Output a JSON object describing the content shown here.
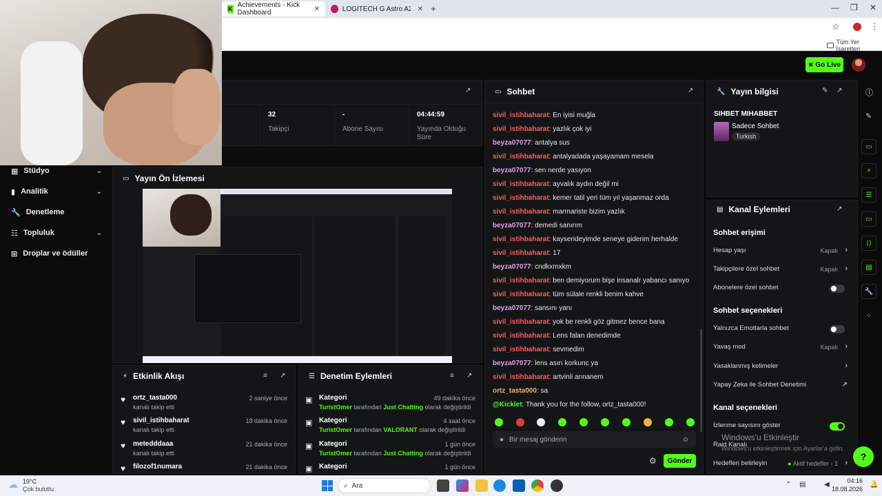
{
  "browser": {
    "tabs": [
      {
        "label": "Achievements - Kick Dashboard"
      },
      {
        "label": "LOGITECH G Astro A20 X Lightn"
      }
    ],
    "bookmarks_label": "Tüm Yer İşaretleri"
  },
  "header": {
    "go_live_label": "Go Live"
  },
  "stats": [
    {
      "value": "32",
      "label": "Takipçi"
    },
    {
      "value": "-",
      "label": "Abone Sayısı"
    },
    {
      "value": "04:44:59",
      "label": "Yayında Olduğu Süre"
    }
  ],
  "sidebar": {
    "items": [
      {
        "label": "Stüdyo",
        "icon": "studio-icon",
        "chevron": true
      },
      {
        "label": "Analitik",
        "icon": "analytics-icon",
        "chevron": true
      },
      {
        "label": "Denetleme",
        "icon": "wrench-icon",
        "chevron": false
      },
      {
        "label": "Topluluk",
        "icon": "community-icon",
        "chevron": true
      },
      {
        "label": "Droplar ve ödüller",
        "icon": "gift-icon",
        "chevron": false
      }
    ]
  },
  "preview": {
    "title": "Yayın Ön İzlemesi"
  },
  "activity": {
    "title": "Etkinlik Akışı",
    "items": [
      {
        "user": "ortz_tasta000",
        "action": "kanalı takip etti",
        "time": "2 saniye önce"
      },
      {
        "user": "sivil_istihbaharat",
        "action": "kanalı takip etti",
        "time": "18 dakika önce"
      },
      {
        "user": "metedddaaa",
        "action": "kanalı takip etti",
        "time": "21 dakika önce"
      },
      {
        "user": "filozof1numara",
        "action": "",
        "time": "21 dakika önce"
      }
    ]
  },
  "moderation": {
    "title": "Denetim Eylemleri",
    "items": [
      {
        "title": "Kategori",
        "actor": "TuristOmer",
        "mid": "tarafından",
        "value": "Just Chatting",
        "tail": "olarak değiştirildi",
        "time": "49 dakika önce"
      },
      {
        "title": "Kategori",
        "actor": "TuristOmer",
        "mid": "tarafından",
        "value": "VALORANT",
        "tail": "olarak değiştirildi",
        "time": "4 saat önce"
      },
      {
        "title": "Kategori",
        "actor": "TuristOmer",
        "mid": "tarafından",
        "value": "Just Chatting",
        "tail": "olarak değiştirildi",
        "time": "1 gün önce"
      },
      {
        "title": "Kategori",
        "actor": "",
        "mid": "",
        "value": "",
        "tail": "",
        "time": "1 gün önce"
      }
    ]
  },
  "chat": {
    "title": "Sohbet",
    "messages": [
      {
        "user": "sivil_istihbaharat",
        "text": "En iyisi muğla",
        "cls": "u1"
      },
      {
        "user": "sivil_istihbaharat",
        "text": "yazlık çok iyi",
        "cls": "u1"
      },
      {
        "user": "beyza07077",
        "text": "antalya sus",
        "cls": "u2"
      },
      {
        "user": "sivil_istihbaharat",
        "text": "antalyadada yaşayamam mesela",
        "cls": "u1"
      },
      {
        "user": "beyza07077",
        "text": "sen nerde yasıyon",
        "cls": "u2"
      },
      {
        "user": "sivil_istihbaharat",
        "text": "ayvalık aydın değil mi",
        "cls": "u1"
      },
      {
        "user": "sivil_istihbaharat",
        "text": "kemer tatil yeri tüm yıl yaşanmaz orda",
        "cls": "u1"
      },
      {
        "user": "sivil_istihbaharat",
        "text": "marmariste bizim yazlık",
        "cls": "u1"
      },
      {
        "user": "beyza07077",
        "text": "demedi sanırım",
        "cls": "u2"
      },
      {
        "user": "sivil_istihbaharat",
        "text": "kayserideyimde seneye giderim herhalde",
        "cls": "u1"
      },
      {
        "user": "sivil_istihbaharat",
        "text": "17",
        "cls": "u1"
      },
      {
        "user": "beyza07077",
        "text": "cndkxmxkm",
        "cls": "u2"
      },
      {
        "user": "sivil_istihbaharat",
        "text": "ben demiyorum bişe insanalr yabancı sanıyo",
        "cls": "u1"
      },
      {
        "user": "sivil_istihbaharat",
        "text": "tüm sülale renkli benim kahve",
        "cls": "u1"
      },
      {
        "user": "beyza07077",
        "text": "sansını yanı",
        "cls": "u2"
      },
      {
        "user": "sivil_istihbaharat",
        "text": "yok be renkli göz gitmez bence bana",
        "cls": "u1"
      },
      {
        "user": "sivil_istihbaharat",
        "text": "Lens falan denedimde",
        "cls": "u1"
      },
      {
        "user": "sivil_istihbaharat",
        "text": "sevmedim",
        "cls": "u1"
      },
      {
        "user": "beyza07077",
        "text": "lens asırı korkunc ya",
        "cls": "u2"
      },
      {
        "user": "sivil_istihbaharat",
        "text": "artvinli annanem",
        "cls": "u1"
      },
      {
        "user": "ortz_tasta000",
        "text": "sa",
        "cls": "u3"
      },
      {
        "user": "@Kicklet",
        "text": "Thank you for the follow, ortz_tasta000!",
        "cls": "u4"
      }
    ],
    "input_placeholder": "Bir mesaj gönderin",
    "send_label": "Gönder"
  },
  "info": {
    "title": "Yayın bilgisi",
    "stream_title": "SIHBET MIHABBET",
    "category": "Sadece Sohbet",
    "language": "Turkish"
  },
  "channel_actions": {
    "title": "Kanal Eylemleri",
    "sections": [
      {
        "heading": "Sohbet erişimi"
      },
      {
        "heading": "Sohbet seçenekleri"
      },
      {
        "heading": "Kanal seçenekleri"
      }
    ],
    "rows": [
      {
        "label": "Hesap yaşı",
        "value": "Kapalı"
      },
      {
        "label": "Takipçilere özel sohbet",
        "value": "Kapalı"
      },
      {
        "label": "Abonelere özel sohbet",
        "value": ""
      },
      {
        "label": "Yalnızca Emotlarla sohbet",
        "value": ""
      },
      {
        "label": "Yavaş mod",
        "value": "Kapalı"
      },
      {
        "label": "Yasaklanmış kelimeler",
        "value": ""
      },
      {
        "label": "Yapay Zeka ile Sohbet Denetimi",
        "value": ""
      },
      {
        "label": "İzlenme sayısını göster",
        "value": ""
      },
      {
        "label": "Raid Kanalı",
        "value": ""
      },
      {
        "label": "Hedefleri belirleyin",
        "value": "Aktif hedefler - 1"
      }
    ]
  },
  "watermark": {
    "line1": "Windows'u Etkinleştir",
    "line2": "Windows'u etkinleştirmek için Ayarlar'a gidin."
  },
  "taskbar": {
    "weather_temp": "19°C",
    "weather_desc": "Çok bulutlu",
    "search_label": "Ara",
    "time": "04:16",
    "date": "18.08.2026"
  },
  "colors": {
    "accent": "#53fc18",
    "panel": "#141517",
    "background": "#0b0b0c"
  }
}
